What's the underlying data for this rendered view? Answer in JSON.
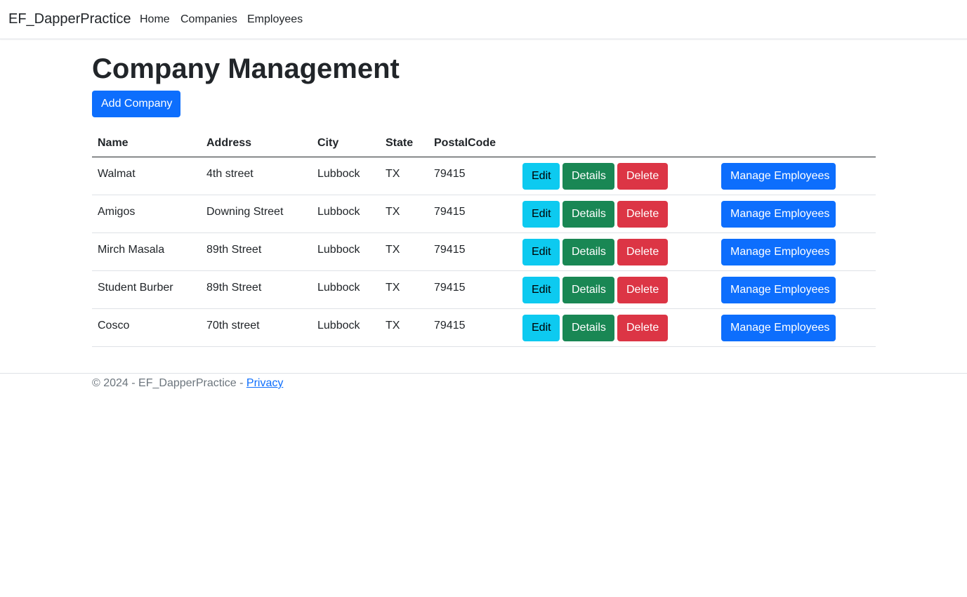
{
  "nav": {
    "brand": "EF_DapperPractice",
    "links": [
      "Home",
      "Companies",
      "Employees"
    ]
  },
  "page": {
    "title": "Company Management",
    "add_button": "Add Company"
  },
  "table": {
    "headers": [
      "Name",
      "Address",
      "City",
      "State",
      "PostalCode"
    ],
    "action_labels": {
      "edit": "Edit",
      "details": "Details",
      "delete": "Delete",
      "manage": "Manage Employees"
    },
    "rows": [
      {
        "name": "Walmat",
        "address": "4th street",
        "city": "Lubbock",
        "state": "TX",
        "postal": "79415"
      },
      {
        "name": "Amigos",
        "address": "Downing Street",
        "city": "Lubbock",
        "state": "TX",
        "postal": "79415"
      },
      {
        "name": "Mirch Masala",
        "address": "89th Street",
        "city": "Lubbock",
        "state": "TX",
        "postal": "79415"
      },
      {
        "name": "Student Burber",
        "address": "89th Street",
        "city": "Lubbock",
        "state": "TX",
        "postal": "79415"
      },
      {
        "name": "Cosco",
        "address": "70th street",
        "city": "Lubbock",
        "state": "TX",
        "postal": "79415"
      }
    ]
  },
  "footer": {
    "text": "© 2024 - EF_DapperPractice -",
    "privacy_link": "Privacy"
  },
  "colors": {
    "primary": "#0d6efd",
    "info": "#0dcaf0",
    "success": "#198754",
    "danger": "#dc3545",
    "muted": "#6c757d"
  }
}
